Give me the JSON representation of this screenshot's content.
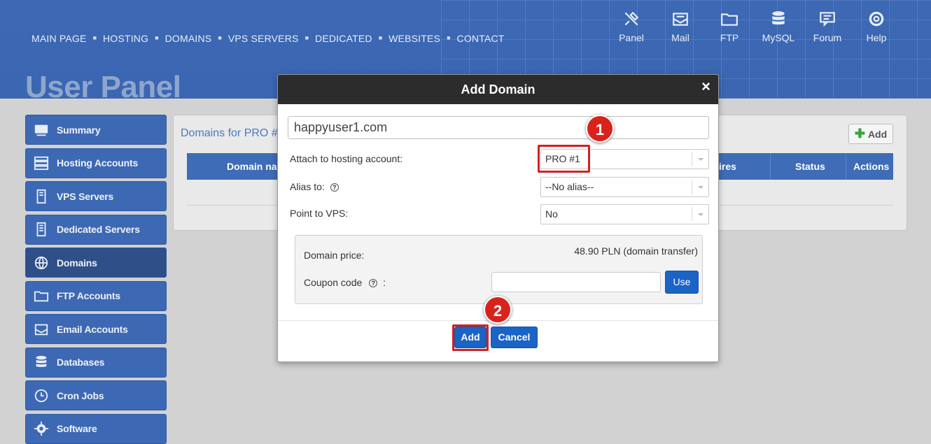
{
  "nav": {
    "items": [
      "MAIN PAGE",
      "HOSTING",
      "DOMAINS",
      "VPS SERVERS",
      "DEDICATED",
      "WEBSITES",
      "CONTACT"
    ],
    "separator": "■"
  },
  "top_icons": [
    {
      "label": "Panel",
      "icon": "tools-icon"
    },
    {
      "label": "Mail",
      "icon": "mail-icon"
    },
    {
      "label": "FTP",
      "icon": "ftp-folder-icon"
    },
    {
      "label": "MySQL",
      "icon": "database-icon"
    },
    {
      "label": "Forum",
      "icon": "forum-icon"
    },
    {
      "label": "Help",
      "icon": "lifebuoy-icon"
    }
  ],
  "page_title": "User Panel",
  "sidebar": {
    "items": [
      {
        "label": "Summary",
        "icon": "monitor-icon"
      },
      {
        "label": "Hosting Accounts",
        "icon": "server-icon"
      },
      {
        "label": "VPS Servers",
        "icon": "vps-icon"
      },
      {
        "label": "Dedicated Servers",
        "icon": "dedicated-server-icon"
      },
      {
        "label": "Domains",
        "icon": "globe-icon",
        "active": true
      },
      {
        "label": "FTP Accounts",
        "icon": "ftp-icon"
      },
      {
        "label": "Email Accounts",
        "icon": "email-icon"
      },
      {
        "label": "Databases",
        "icon": "database-icon"
      },
      {
        "label": "Cron Jobs",
        "icon": "clock-icon"
      },
      {
        "label": "Software",
        "icon": "gear-icon"
      }
    ]
  },
  "panel": {
    "title": "Domains for PRO #",
    "add_label": "Add",
    "columns": [
      "Domain na",
      "ires",
      "Status",
      "Actions"
    ]
  },
  "modal": {
    "title": "Add Domain",
    "close": "×",
    "domain_value": "happyuser1.com",
    "attach_label": "Attach to hosting account:",
    "attach_value": "PRO #1",
    "alias_label": "Alias to:",
    "alias_value": "--No alias--",
    "vps_label": "Point to VPS:",
    "vps_value": "No",
    "help_glyph": "?",
    "price_label": "Domain price:",
    "price_value": "48.90 PLN (domain transfer)",
    "coupon_label": "Coupon code",
    "coupon_suffix": ":",
    "coupon_value": "",
    "use_label": "Use",
    "add_label": "Add",
    "cancel_label": "Cancel"
  },
  "annotations": {
    "badge1": "1",
    "badge2": "2"
  },
  "colors": {
    "header": "#3a66b2",
    "sidebar": "#3d68b3",
    "button": "#1b63c6",
    "highlight": "#d42020"
  }
}
